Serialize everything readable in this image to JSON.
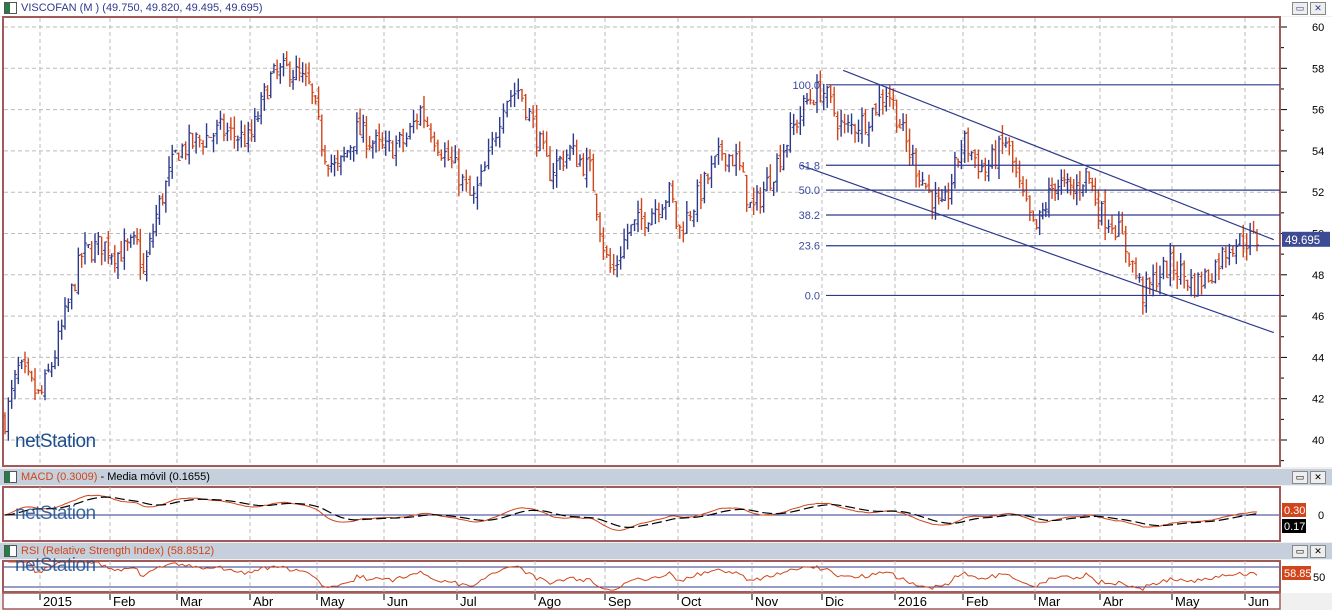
{
  "window": {
    "title": "VISCOFAN (M ) (49.750, 49.820, 49.495, 49.695)",
    "maximize_icon": "maximize-icon",
    "close_icon": "close-icon",
    "close_label": "✕",
    "max_label": "▭"
  },
  "watermark": {
    "brand_a": "net",
    "brand_b": "Station"
  },
  "colors": {
    "up": "#2d3a8c",
    "down": "#d0451b",
    "frame": "#a05a5a",
    "line": "#2d3a8c"
  },
  "chart_data": {
    "type": "ohlc",
    "symbol": "VISCOFAN",
    "last": {
      "open": 49.75,
      "high": 49.82,
      "low": 49.495,
      "close": 49.695
    },
    "last_label": "49.695",
    "ylim": [
      39,
      61
    ],
    "yticks": [
      "40",
      "42",
      "44",
      "46",
      "48",
      "50",
      "52",
      "54",
      "56",
      "58",
      "60"
    ],
    "x_months": [
      "2015",
      "Feb",
      "Mar",
      "Abr",
      "May",
      "Jun",
      "Jul",
      "Ago",
      "Sep",
      "Oct",
      "Nov",
      "Dic",
      "2016",
      "Feb",
      "Mar",
      "Abr",
      "May",
      "Jun"
    ],
    "close_waypoints_month_price": [
      [
        -0.5,
        41
      ],
      [
        -0.3,
        43.5
      ],
      [
        0,
        42
      ],
      [
        0.2,
        44
      ],
      [
        0.4,
        46.5
      ],
      [
        0.6,
        49
      ],
      [
        0.9,
        49.5
      ],
      [
        1.1,
        49
      ],
      [
        1.4,
        49.5
      ],
      [
        1.5,
        48
      ],
      [
        1.7,
        51
      ],
      [
        2.0,
        54
      ],
      [
        2.3,
        54.5
      ],
      [
        2.6,
        55
      ],
      [
        3.0,
        54.5
      ],
      [
        3.3,
        57.5
      ],
      [
        3.6,
        58
      ],
      [
        3.9,
        57
      ],
      [
        4.1,
        54
      ],
      [
        4.3,
        53
      ],
      [
        4.6,
        55
      ],
      [
        5.0,
        54
      ],
      [
        5.3,
        54.5
      ],
      [
        5.5,
        56
      ],
      [
        5.8,
        54
      ],
      [
        6.0,
        53
      ],
      [
        6.2,
        51.5
      ],
      [
        6.4,
        53.5
      ],
      [
        6.6,
        56.5
      ],
      [
        6.8,
        57
      ],
      [
        7.0,
        55
      ],
      [
        7.2,
        53
      ],
      [
        7.5,
        54
      ],
      [
        7.8,
        53
      ],
      [
        8.0,
        49
      ],
      [
        8.1,
        48
      ],
      [
        8.3,
        50
      ],
      [
        8.6,
        51
      ],
      [
        8.9,
        52
      ],
      [
        9.0,
        50
      ],
      [
        9.3,
        52
      ],
      [
        9.6,
        54
      ],
      [
        9.8,
        53.5
      ],
      [
        10.0,
        51
      ],
      [
        10.3,
        53
      ],
      [
        10.5,
        54.5
      ],
      [
        10.8,
        56.5
      ],
      [
        11.0,
        57
      ],
      [
        11.3,
        55
      ],
      [
        11.6,
        55.5
      ],
      [
        11.9,
        57
      ],
      [
        12.2,
        54
      ],
      [
        12.5,
        52
      ],
      [
        12.7,
        51
      ],
      [
        13.0,
        54.5
      ],
      [
        13.3,
        53
      ],
      [
        13.6,
        54.5
      ],
      [
        13.8,
        52
      ],
      [
        14.0,
        50
      ],
      [
        14.3,
        52.5
      ],
      [
        14.6,
        52
      ],
      [
        14.8,
        53
      ],
      [
        15.0,
        51
      ],
      [
        15.2,
        50.5
      ],
      [
        15.4,
        49
      ],
      [
        15.6,
        47
      ],
      [
        15.8,
        48
      ],
      [
        16.0,
        48.5
      ],
      [
        16.3,
        47.5
      ],
      [
        16.5,
        48
      ],
      [
        16.8,
        49.5
      ],
      [
        17.0,
        49.7
      ],
      [
        17.2,
        49.695
      ]
    ],
    "fibonacci": {
      "high": 57.2,
      "low": 47.0,
      "levels": [
        "100.0",
        "61.8",
        "50.0",
        "38.2",
        "23.6",
        "0.0"
      ]
    },
    "channel": {
      "upper": [
        [
          11.29,
          57.9
        ],
        [
          17.4,
          49.7
        ]
      ],
      "lower": [
        [
          10.7,
          53.3
        ],
        [
          17.4,
          45.2
        ]
      ]
    },
    "macd": {
      "label": "MACD (0.3009)",
      "signal_label": "Media móvil (0.1655)",
      "value_tag": "0.30",
      "signal_tag": "0.17",
      "zero_label": "0"
    },
    "rsi": {
      "label": "RSI (Relative Strength Index) (58.8512)",
      "value_tag": "58.85",
      "mid_label": "50"
    }
  }
}
